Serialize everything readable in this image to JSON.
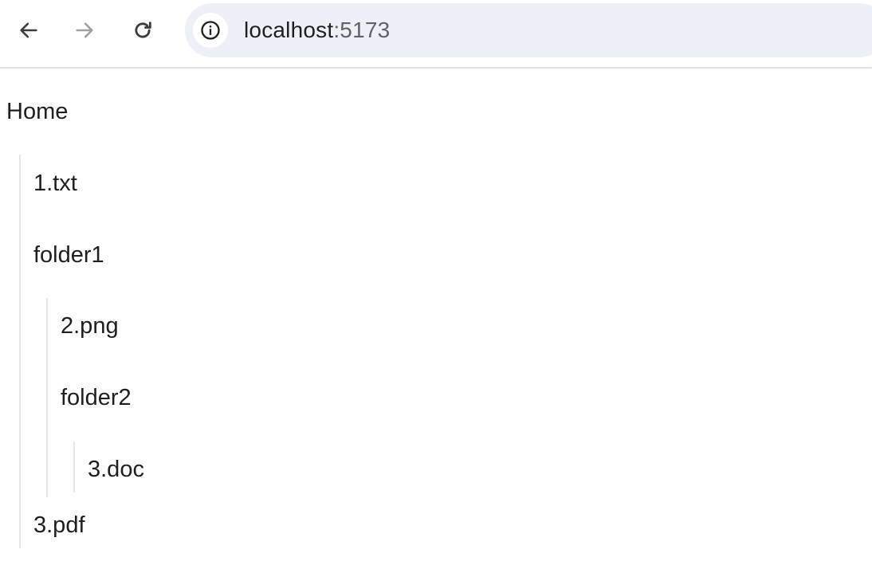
{
  "browser": {
    "back_icon": "arrow-left-icon",
    "forward_icon": "arrow-right-icon",
    "reload_icon": "reload-icon",
    "site_info_icon": "info-icon",
    "url_host": "localhost",
    "url_port": ":5173"
  },
  "tree": {
    "root_label": "Home",
    "items": [
      {
        "label": "1.txt",
        "depth": 1
      },
      {
        "label": "folder1",
        "depth": 1
      },
      {
        "label": "2.png",
        "depth": 2
      },
      {
        "label": "folder2",
        "depth": 2
      },
      {
        "label": "3.doc",
        "depth": 3
      },
      {
        "label": "3.pdf",
        "depth": 1
      }
    ]
  },
  "colors": {
    "omnibox_bg": "#edf0f6",
    "guide_line": "#e6e6e6",
    "forward_disabled": "#a0a0a0"
  }
}
